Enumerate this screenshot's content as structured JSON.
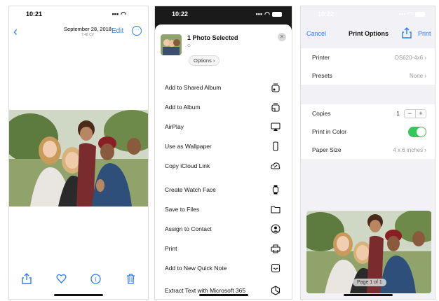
{
  "phone1": {
    "status_time": "10:21",
    "date": "September 28, 2018",
    "date_sub": "7:48 CV",
    "edit_label": "Edit",
    "toolbar": [
      "share-icon",
      "heart-icon",
      "info-icon",
      "trash-icon"
    ]
  },
  "phone2": {
    "status_time": "10:22",
    "selection_title": "1 Photo Selected",
    "options_label": "Options ›",
    "actions": [
      {
        "label": "Add to Shared Album",
        "icon": "shared-album-icon"
      },
      {
        "label": "Add to Album",
        "icon": "album-icon"
      },
      {
        "label": "AirPlay",
        "icon": "airplay-icon"
      },
      {
        "label": "Use as Wallpaper",
        "icon": "phone-icon"
      },
      {
        "label": "Copy iCloud Link",
        "icon": "cloud-link-icon"
      },
      {
        "label": "Create Watch Face",
        "icon": "watch-icon"
      },
      {
        "label": "Save to Files",
        "icon": "folder-icon"
      },
      {
        "label": "Assign to Contact",
        "icon": "contact-icon"
      },
      {
        "label": "Print",
        "icon": "printer-icon"
      },
      {
        "label": "Add to New Quick Note",
        "icon": "quick-note-icon"
      },
      {
        "label": "Extract Text with Microsoft 365",
        "icon": "office-icon"
      }
    ]
  },
  "phone3": {
    "status_time": "10:22",
    "cancel_label": "Cancel",
    "title": "Print Options",
    "print_label": "Print",
    "printer_label": "Printer",
    "printer_value": "DS620-4x6",
    "presets_label": "Presets",
    "presets_value": "None",
    "copies_label": "Copies",
    "copies_value": "1",
    "stepper_minus": "−",
    "stepper_plus": "+",
    "print_color_label": "Print in Color",
    "print_color_on": true,
    "paper_size_label": "Paper Size",
    "paper_size_value": "4 x 6 inches",
    "page_badge": "Page 1 of 1"
  },
  "colors": {
    "accent": "#2f7bf6",
    "toggle_on": "#34c759"
  }
}
